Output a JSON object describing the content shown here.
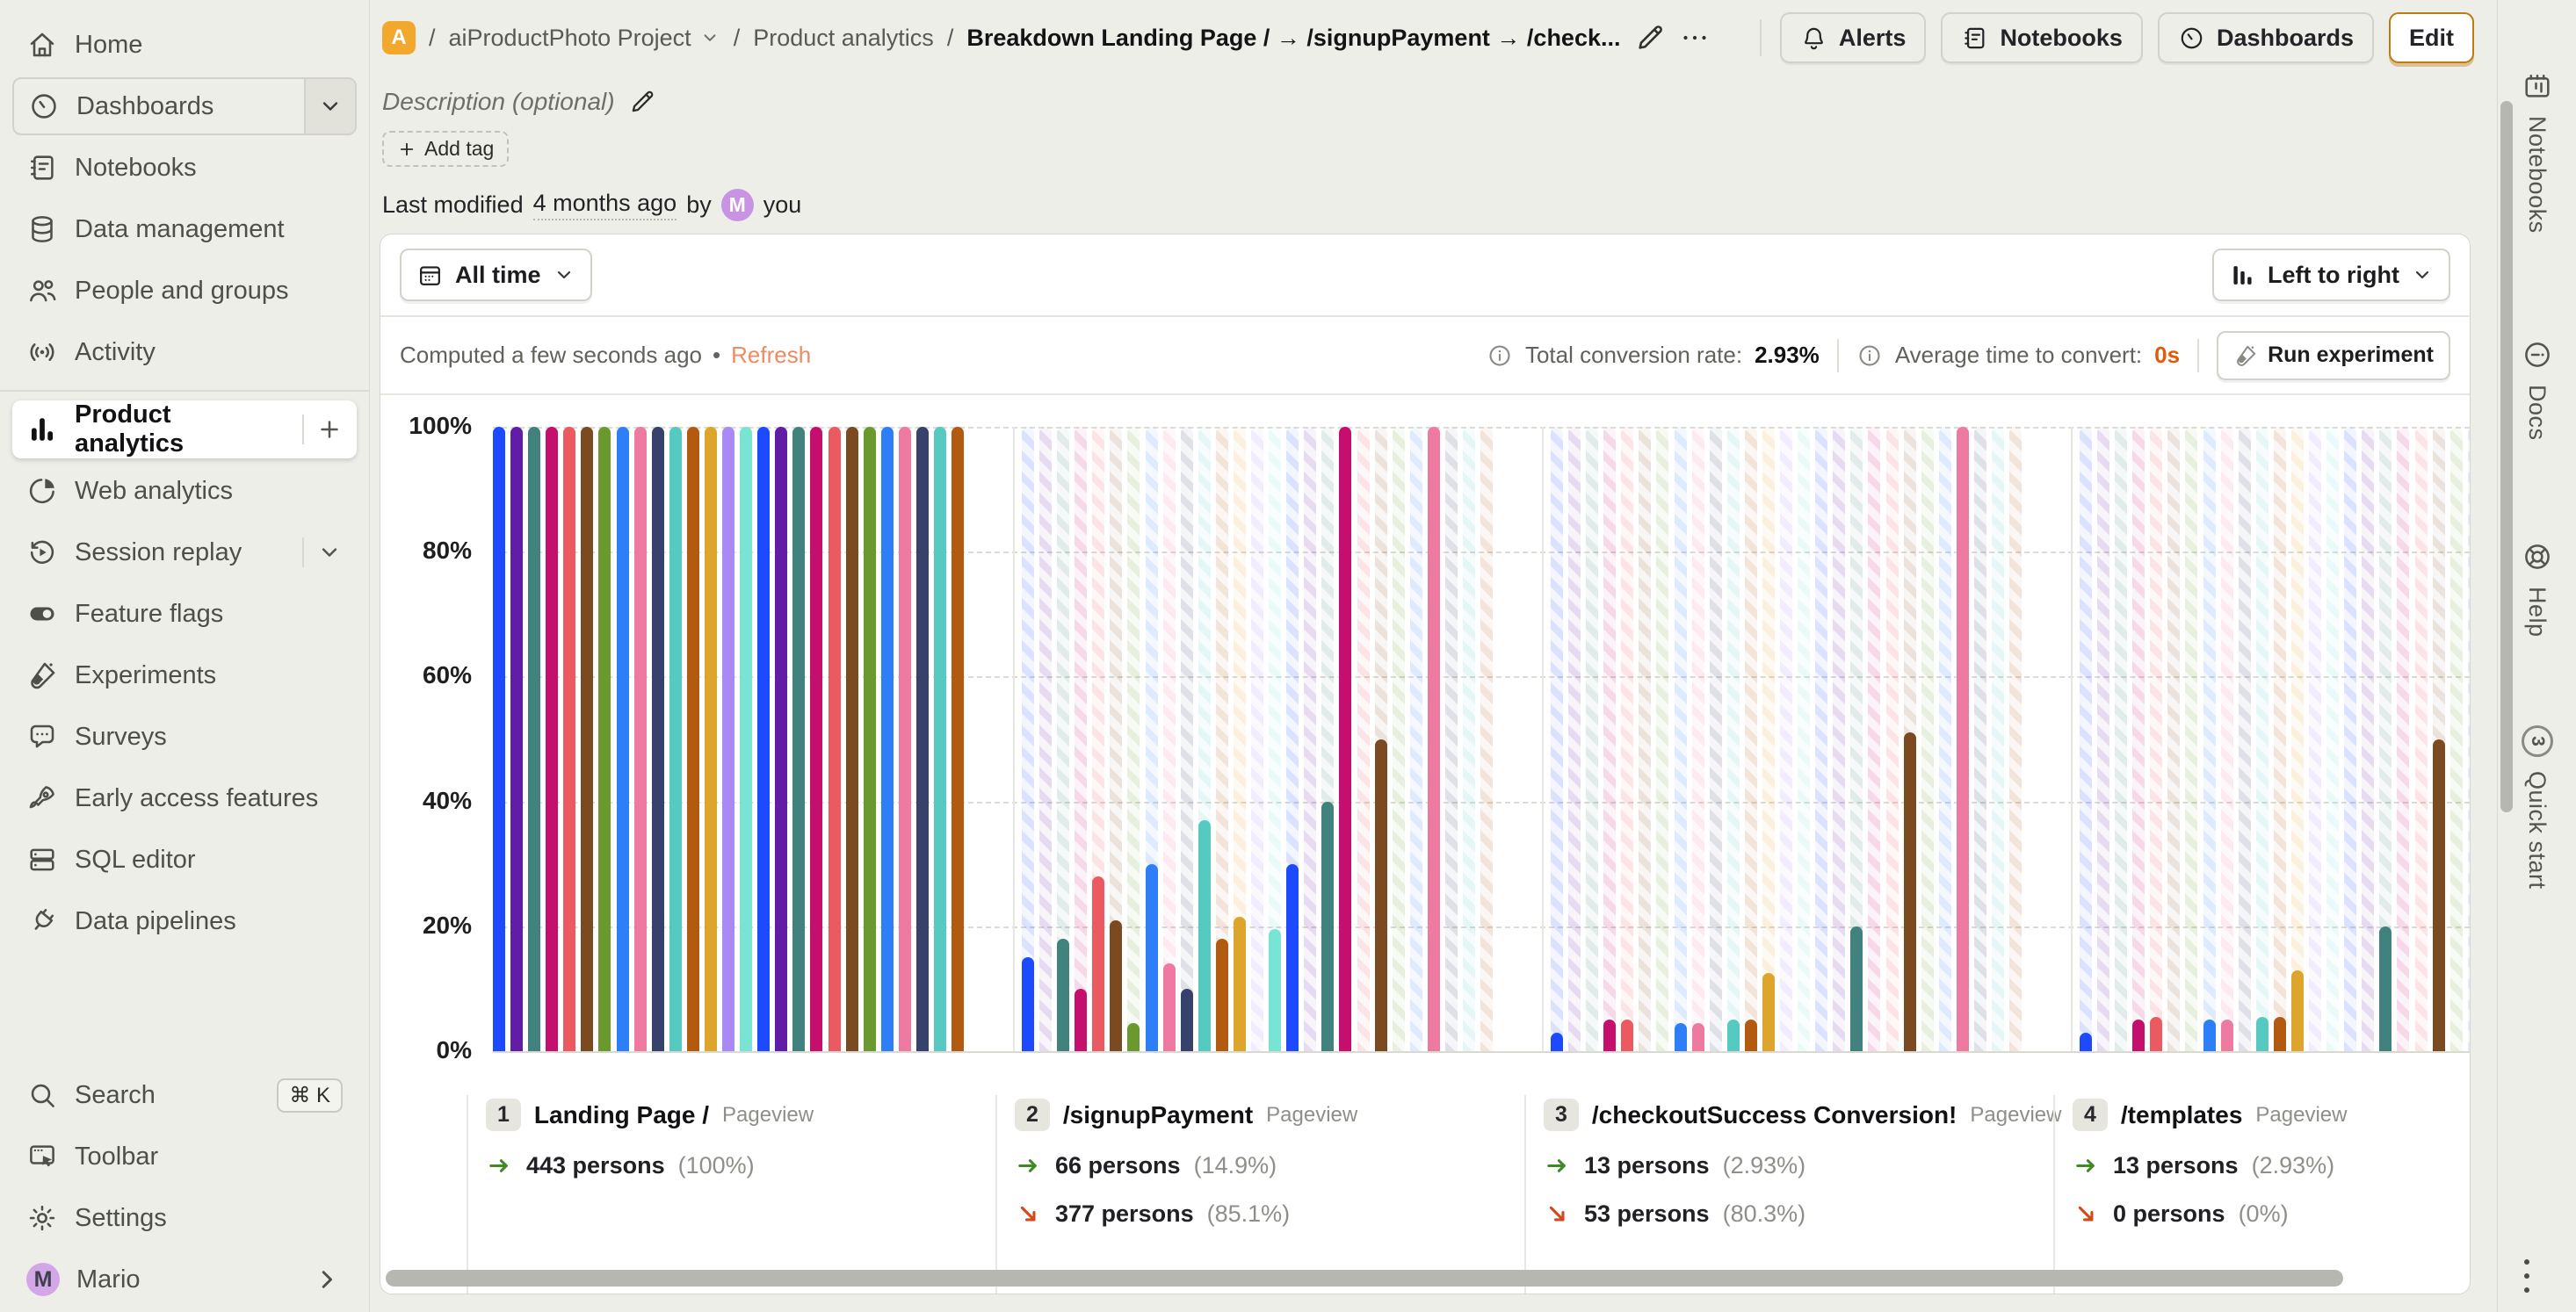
{
  "topbar": {
    "sep": "/",
    "project_badge": "A",
    "project": "aiProductPhoto Project",
    "section": "Product analytics",
    "current": "Breakdown Landing Page / → /signupPayment → /check...",
    "buttons": [
      {
        "id": "alerts",
        "label": "Alerts",
        "icon": "bell"
      },
      {
        "id": "notebooks",
        "label": "Notebooks",
        "icon": "notebook"
      },
      {
        "id": "dashboards",
        "label": "Dashboards",
        "icon": "gauge"
      },
      {
        "id": "edit",
        "label": "Edit",
        "primary": true
      }
    ]
  },
  "sidebar": {
    "items": [
      {
        "id": "home",
        "icon": "home",
        "label": "Home"
      },
      {
        "id": "dashboards",
        "icon": "gauge",
        "label": "Dashboards",
        "boxed": true,
        "trailing": "chevron"
      },
      {
        "id": "notebooks",
        "icon": "notebook",
        "label": "Notebooks"
      },
      {
        "id": "data-management",
        "icon": "database",
        "label": "Data management"
      },
      {
        "id": "people-and-groups",
        "icon": "people",
        "label": "People and groups"
      },
      {
        "id": "activity",
        "icon": "activity",
        "label": "Activity"
      },
      {
        "divider": true
      },
      {
        "id": "product-analytics",
        "icon": "bar-chart",
        "label": "Product analytics",
        "active": true,
        "trailing": "plus"
      },
      {
        "id": "web-analytics",
        "icon": "pie",
        "label": "Web analytics"
      },
      {
        "id": "session-replay",
        "icon": "replay",
        "label": "Session replay",
        "trailing": "chevron"
      },
      {
        "id": "feature-flags",
        "icon": "toggle",
        "label": "Feature flags"
      },
      {
        "id": "experiments",
        "icon": "flask",
        "label": "Experiments"
      },
      {
        "id": "surveys",
        "icon": "chat",
        "label": "Surveys"
      },
      {
        "id": "early-access-features",
        "icon": "rocket",
        "label": "Early access features"
      },
      {
        "id": "sql-editor",
        "icon": "sql",
        "label": "SQL editor"
      },
      {
        "id": "data-pipelines",
        "icon": "plug",
        "label": "Data pipelines"
      }
    ],
    "footer": [
      {
        "id": "search",
        "icon": "search",
        "label": "Search",
        "kbd": "⌘ K"
      },
      {
        "id": "toolbar",
        "icon": "toolbar",
        "label": "Toolbar"
      },
      {
        "id": "settings",
        "icon": "gear",
        "label": "Settings"
      },
      {
        "id": "user",
        "avatar": "M",
        "label": "Mario",
        "trailing": "chevron-right"
      }
    ]
  },
  "header": {
    "description": "Description (optional)",
    "add_tag": "Add tag",
    "last_modified": {
      "prefix": "Last modified",
      "time": "4 months ago",
      "by": "by",
      "avatar": "M",
      "user": "you"
    }
  },
  "query": {
    "date_range": "All time",
    "order": "Left to right",
    "computed": "Computed a few seconds ago",
    "bullet": "•",
    "refresh": "Refresh",
    "stats": [
      {
        "label": "Total conversion rate:",
        "value": "2.93%",
        "accent": false
      },
      {
        "label": "Average time to convert:",
        "value": "0s",
        "accent": true
      }
    ],
    "run_experiment": "Run experiment"
  },
  "chart_data": {
    "type": "bar",
    "variant": "funnel-steps-with-breakdown",
    "y_ticks": [
      "100%",
      "80%",
      "60%",
      "40%",
      "20%",
      "0%"
    ],
    "ylim": [
      0,
      100
    ],
    "grid": "dashed-horizontal",
    "categories": [
      "Landing Page /",
      "/signupPayment",
      "/checkoutSuccess Conversion!",
      "/templates"
    ],
    "palette": [
      "#1d4aff",
      "#621da6",
      "#42827e",
      "#c40f6e",
      "#ea5a60",
      "#7c4a21",
      "#6a9a2e",
      "#2e7ff7",
      "#ee7aa2",
      "#36426b",
      "#56c9c1",
      "#b35a11",
      "#dda52b",
      "#a98af5",
      "#79e3d4"
    ],
    "series_note": "27 breakdown series; color = palette[index % 15]; values are conversion % per funnel step",
    "series": [
      [
        100,
        15,
        3,
        3
      ],
      [
        100,
        0,
        0,
        0
      ],
      [
        100,
        18,
        0,
        0
      ],
      [
        100,
        10,
        5,
        5
      ],
      [
        100,
        28,
        5,
        5.5
      ],
      [
        100,
        21,
        0,
        0
      ],
      [
        100,
        4.5,
        0,
        0
      ],
      [
        100,
        30,
        4.5,
        5
      ],
      [
        100,
        14,
        4.5,
        5
      ],
      [
        100,
        10,
        0,
        0
      ],
      [
        100,
        37,
        5,
        5.5
      ],
      [
        100,
        18,
        5,
        5.5
      ],
      [
        100,
        21.5,
        12.5,
        13
      ],
      [
        100,
        0,
        0,
        0
      ],
      [
        100,
        19.5,
        0,
        0
      ],
      [
        100,
        30,
        0,
        0
      ],
      [
        100,
        0,
        0,
        0
      ],
      [
        100,
        40,
        20,
        20
      ],
      [
        100,
        100,
        0,
        0
      ],
      [
        100,
        0,
        0,
        0
      ],
      [
        100,
        50,
        51,
        50
      ],
      [
        100,
        0,
        0,
        0
      ],
      [
        100,
        0,
        0,
        0
      ],
      [
        100,
        100,
        100,
        100
      ],
      [
        100,
        0,
        0,
        0
      ],
      [
        100,
        0,
        0,
        0
      ],
      [
        100,
        0,
        0,
        0
      ]
    ]
  },
  "steps": [
    {
      "num": "1",
      "name": "Landing Page /",
      "event": "Pageview",
      "completed": {
        "count": "443 persons",
        "pct": "(100%)"
      }
    },
    {
      "num": "2",
      "name": "/signupPayment",
      "event": "Pageview",
      "completed": {
        "count": "66 persons",
        "pct": "(14.9%)"
      },
      "dropped": {
        "count": "377 persons",
        "pct": "(85.1%)"
      }
    },
    {
      "num": "3",
      "name": "/checkoutSuccess Conversion!",
      "event": "Pageview",
      "completed": {
        "count": "13 persons",
        "pct": "(2.93%)"
      },
      "dropped": {
        "count": "53 persons",
        "pct": "(80.3%)"
      }
    },
    {
      "num": "4",
      "name": "/templates",
      "event": "Pageview",
      "completed": {
        "count": "13 persons",
        "pct": "(2.93%)"
      },
      "dropped": {
        "count": "0 persons",
        "pct": "(0%)"
      }
    }
  ],
  "side_panel": {
    "tabs": [
      {
        "id": "notebooks",
        "icon": "notebook",
        "label": "Notebooks"
      },
      {
        "id": "docs",
        "icon": "info",
        "label": "Docs"
      },
      {
        "id": "help",
        "icon": "lifebuoy",
        "label": "Help"
      },
      {
        "id": "quick-start",
        "icon": "badge",
        "label": "Quick start",
        "badge": "3"
      }
    ]
  },
  "colors": {
    "background": "#edeee8",
    "accent_orange": "#c07a12",
    "refresh_link": "#ef8a63",
    "stat_orange": "#e25a0a",
    "success_green": "#3e8b26",
    "drop_red": "#d24a1c",
    "project_badge_bg": "#f2a82d",
    "avatar_purple": "#c893e3"
  }
}
